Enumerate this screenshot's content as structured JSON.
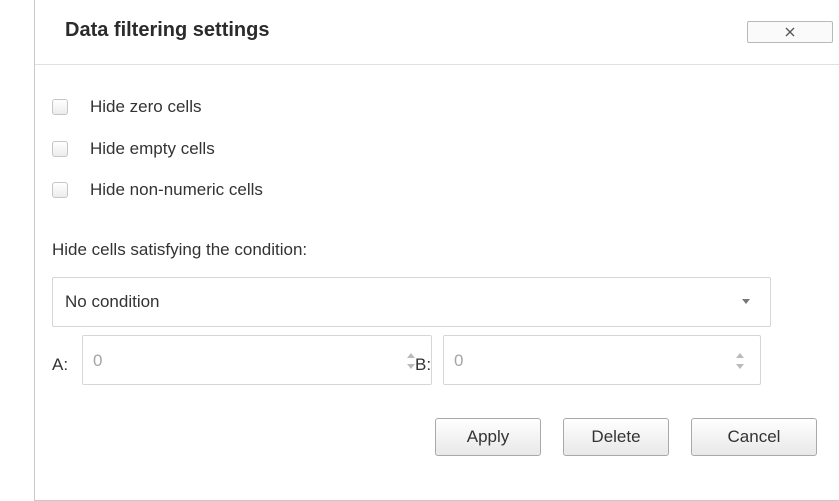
{
  "dialog": {
    "title": "Data filtering settings",
    "close_icon": "close-icon"
  },
  "options": [
    {
      "label": "Hide zero cells",
      "checked": false
    },
    {
      "label": "Hide empty cells",
      "checked": false
    },
    {
      "label": "Hide non-numeric cells",
      "checked": false
    }
  ],
  "condition": {
    "label": "Hide cells satisfying the condition:",
    "selected": "No condition"
  },
  "fields": {
    "a_label": "A:",
    "a_value": "0",
    "b_label": "B:",
    "b_value": "0"
  },
  "buttons": {
    "apply": "Apply",
    "delete": "Delete",
    "cancel": "Cancel"
  }
}
